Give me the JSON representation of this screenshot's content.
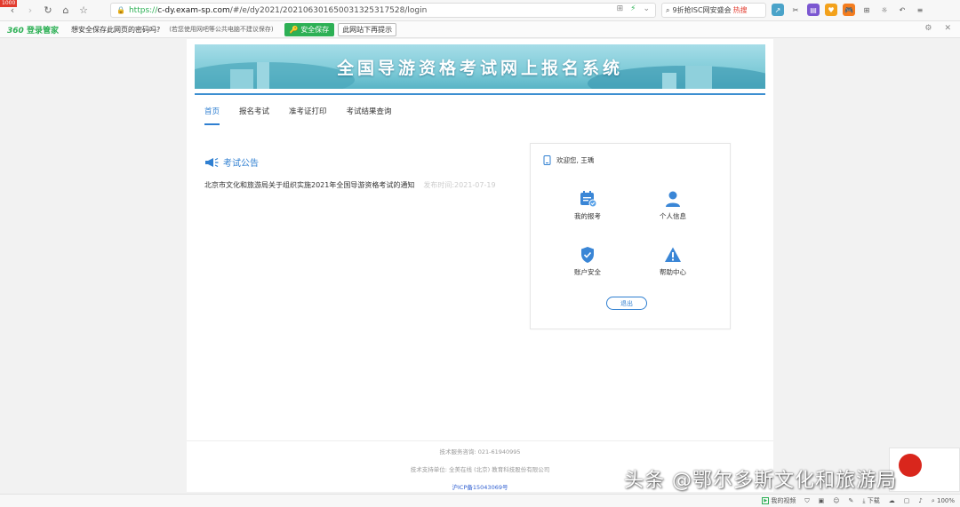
{
  "browser": {
    "corner_badge": "1000",
    "url_protocol": "https://",
    "url_host": "c-dy.exam-sp.com",
    "url_path": "/#/e/dy2021/2021063016500313253175​28/login",
    "search_text": "9折抢ISC网安盛会",
    "search_hot": "热搜",
    "infobar_brand": "360",
    "infobar_brand_suffix": "登录管家",
    "infobar_question": "想安全保存此网页的密码吗?",
    "infobar_note": "(若您使用网吧等公共电脑不建议保存)",
    "infobar_save_label": "安全保存",
    "infobar_nomore_label": "此网站下再提示"
  },
  "banner": {
    "title": "全国导游资格考试网上报名系统"
  },
  "tabs": [
    {
      "label": "首页",
      "active": true
    },
    {
      "label": "报名考试",
      "active": false
    },
    {
      "label": "准考证打印",
      "active": false
    },
    {
      "label": "考试结果查询",
      "active": false
    }
  ],
  "notice": {
    "heading": "考试公告",
    "items": [
      {
        "title": "北京市文化和旅游局关于组织实施2021年全国导游资格考试的通知",
        "time": "发布时间:2021-07-19"
      }
    ]
  },
  "user_card": {
    "welcome": "欢迎您, 王瑀",
    "items": [
      {
        "label": "我的报考",
        "icon": "calendar-check-icon"
      },
      {
        "label": "个人信息",
        "icon": "user-icon"
      },
      {
        "label": "账户安全",
        "icon": "shield-check-icon"
      },
      {
        "label": "帮助中心",
        "icon": "warning-icon"
      }
    ],
    "logout_label": "退出"
  },
  "footer": {
    "hotline": "技术服务咨询: 021-61940995",
    "support": "技术支持单位: 全美在线 (北京) 教育科技股份有限公司",
    "icp": "沪ICP备15043069号"
  },
  "statusbar": {
    "video_label": "我的视频",
    "download_label": "下载",
    "zoom": "100%"
  },
  "watermark": {
    "text": "头条 @鄂尔多斯文化和旅游局"
  },
  "colors": {
    "accent": "#2f7fd1",
    "brand_green": "#2db055"
  }
}
